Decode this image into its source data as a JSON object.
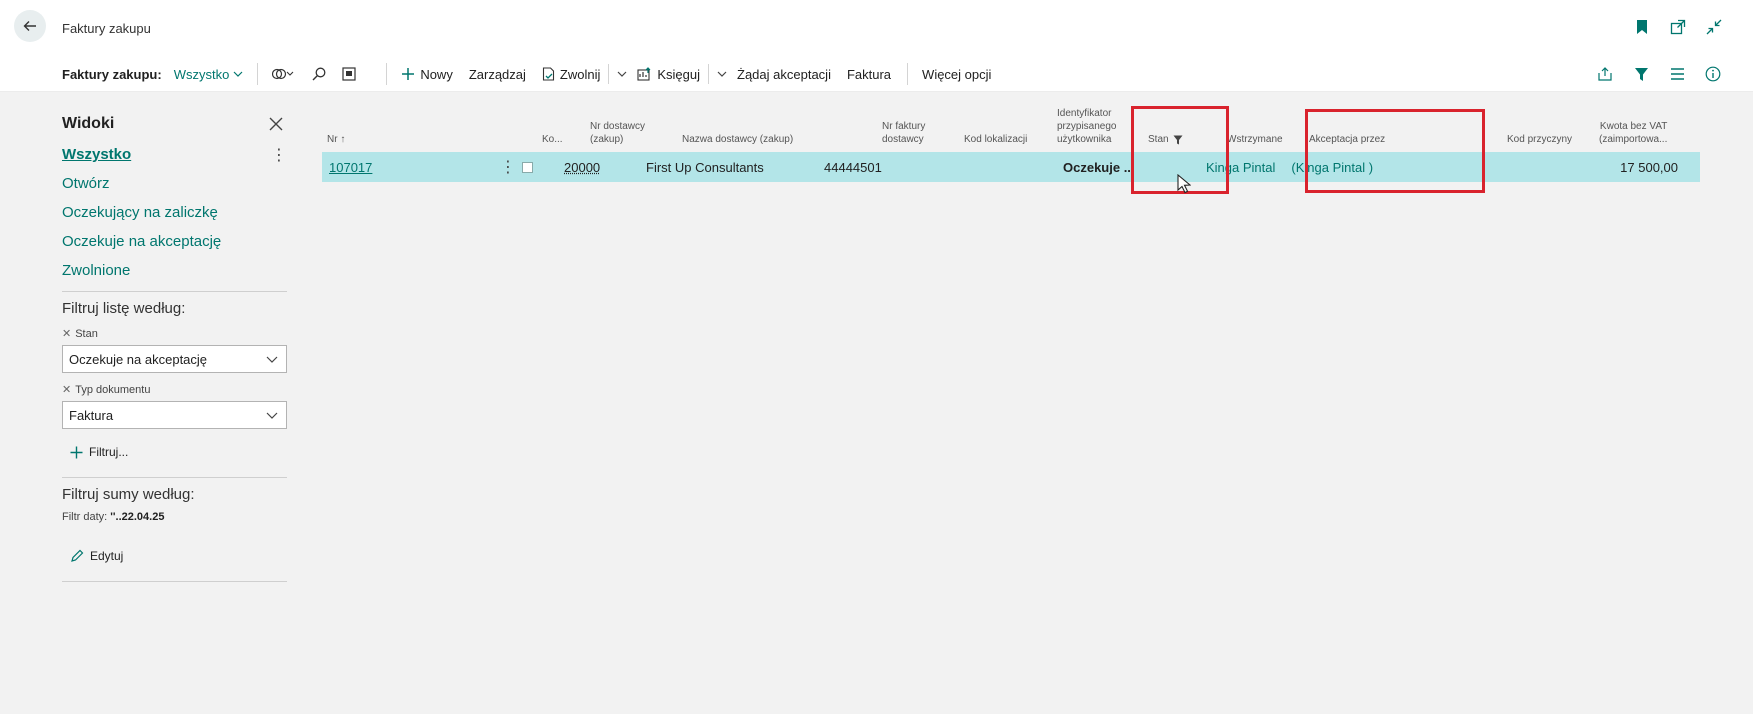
{
  "header": {
    "page_title": "Faktury zakupu"
  },
  "toolbar": {
    "title": "Faktury zakupu:",
    "view": "Wszystko",
    "new": "Nowy",
    "manage": "Zarządzaj",
    "release": "Zwolnij",
    "post": "Księguj",
    "request_approval": "Żądaj akceptacji",
    "invoice": "Faktura",
    "more": "Więcej opcji"
  },
  "sidebar": {
    "title": "Widoki",
    "views": [
      "Wszystko",
      "Otwórz",
      "Oczekujący na zaliczkę",
      "Oczekuje na akceptację",
      "Zwolnione"
    ],
    "filter_title": "Filtruj listę według:",
    "filters": [
      {
        "label": "Stan",
        "value": "Oczekuje na akceptację"
      },
      {
        "label": "Typ dokumentu",
        "value": "Faktura"
      }
    ],
    "add_filter": "Filtruj...",
    "totals_title": "Filtruj sumy według:",
    "date_filter_label": "Filtr daty:",
    "date_filter_value": "''..22.04.25",
    "edit": "Edytuj"
  },
  "table": {
    "columns": {
      "nr": "Nr",
      "ko": "Ko...",
      "vendor_no_1": "Nr dostawcy",
      "vendor_no_2": "(zakup)",
      "vendor_name": "Nazwa dostawcy (zakup)",
      "vendor_inv_1": "Nr faktury",
      "vendor_inv_2": "dostawcy",
      "location": "Kod lokalizacji",
      "user_id_1": "Identyfikator",
      "user_id_2": "przypisanego",
      "user_id_3": "użytkownika",
      "status": "Stan",
      "on_hold": "Wstrzymane",
      "approver": "Akceptacja przez",
      "reason": "Kod przyczyny",
      "amount_1": "Kwota bez VAT",
      "amount_2": "(zaimportowa..."
    },
    "rows": [
      {
        "nr": "107017",
        "vendor_no": "20000",
        "vendor_name": "First Up Consultants",
        "vendor_invoice": "44444501",
        "status": "Oczekuje ...",
        "approver": "Kinga Pintal",
        "approver_paren": "(Kinga Pintal )",
        "amount": "17 500,00"
      }
    ]
  },
  "colors": {
    "accent": "#00766e",
    "row_selected": "#b3e5e8",
    "highlight": "#d9232d"
  }
}
